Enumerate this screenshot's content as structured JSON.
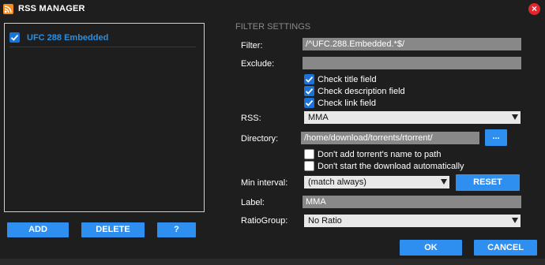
{
  "window": {
    "title": "RSS MANAGER"
  },
  "list": {
    "items": [
      {
        "label": "UFC 288 Embedded",
        "checked": true
      }
    ]
  },
  "list_buttons": {
    "add": "ADD",
    "delete": "DELETE",
    "help": "?"
  },
  "filter_settings": {
    "section_title": "FILTER SETTINGS",
    "filter": {
      "label": "Filter:",
      "value": "/^UFC.288.Embedded.*$/"
    },
    "exclude": {
      "label": "Exclude:",
      "value": ""
    },
    "check_title": {
      "label": "Check title field",
      "checked": true
    },
    "check_description": {
      "label": "Check description field",
      "checked": true
    },
    "check_link": {
      "label": "Check link field",
      "checked": true
    },
    "rss": {
      "label": "RSS:",
      "selected": "MMA"
    },
    "directory": {
      "label": "Directory:",
      "value": "/home/download/torrents/rtorrent/",
      "browse": "..."
    },
    "no_name_path": {
      "label": "Don't add torrent's name to path",
      "checked": false
    },
    "no_autostart": {
      "label": "Don't start the download automatically",
      "checked": false
    },
    "min_interval": {
      "label": "Min interval:",
      "selected": "(match always)",
      "reset": "RESET"
    },
    "label_field": {
      "label": "Label:",
      "value": "MMA"
    },
    "ratio_group": {
      "label": "RatioGroup:",
      "selected": "No Ratio"
    }
  },
  "dialog_buttons": {
    "ok": "OK",
    "cancel": "CANCEL"
  },
  "colors": {
    "background": "#1e1e1e",
    "accent": "#2f8ff0",
    "link": "#2a8fe0",
    "close": "#e3262c",
    "rss_icon": "#f38b1e"
  },
  "icons": [
    "rss-icon",
    "close-icon",
    "checkbox-icon",
    "dropdown-arrow-icon"
  ]
}
